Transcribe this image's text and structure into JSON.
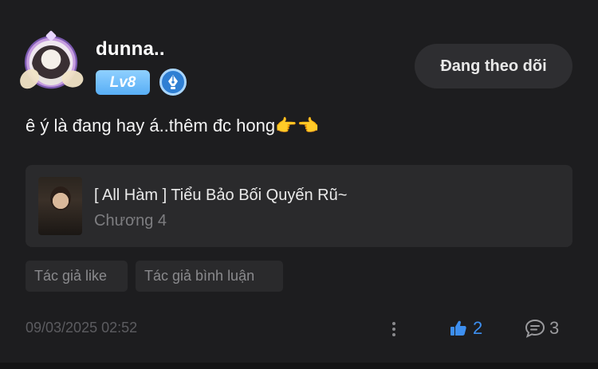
{
  "user": {
    "name": "dunna..",
    "level": "Lv8"
  },
  "follow": {
    "label": "Đang theo dõi"
  },
  "comment": {
    "text": "ê ý là đang hay á..thêm đc hong👉👈"
  },
  "story": {
    "title": "[ All Hàm ] Tiểu Bảo Bối Quyến Rũ~",
    "chapter": "Chương 4"
  },
  "tags": [
    {
      "label": "Tác giả like"
    },
    {
      "label": "Tác giả bình luận"
    }
  ],
  "footer": {
    "timestamp": "09/03/2025 02:52",
    "likes": "2",
    "comments": "3"
  },
  "colors": {
    "background": "#1d1d1f",
    "accent": "#3d8ff0",
    "level_badge": "#58aef5"
  },
  "icons": {
    "pen_badge": "pen-nib-icon",
    "more": "more-vertical-icon",
    "like": "thumbs-up-icon",
    "comment": "comment-bubble-icon"
  }
}
